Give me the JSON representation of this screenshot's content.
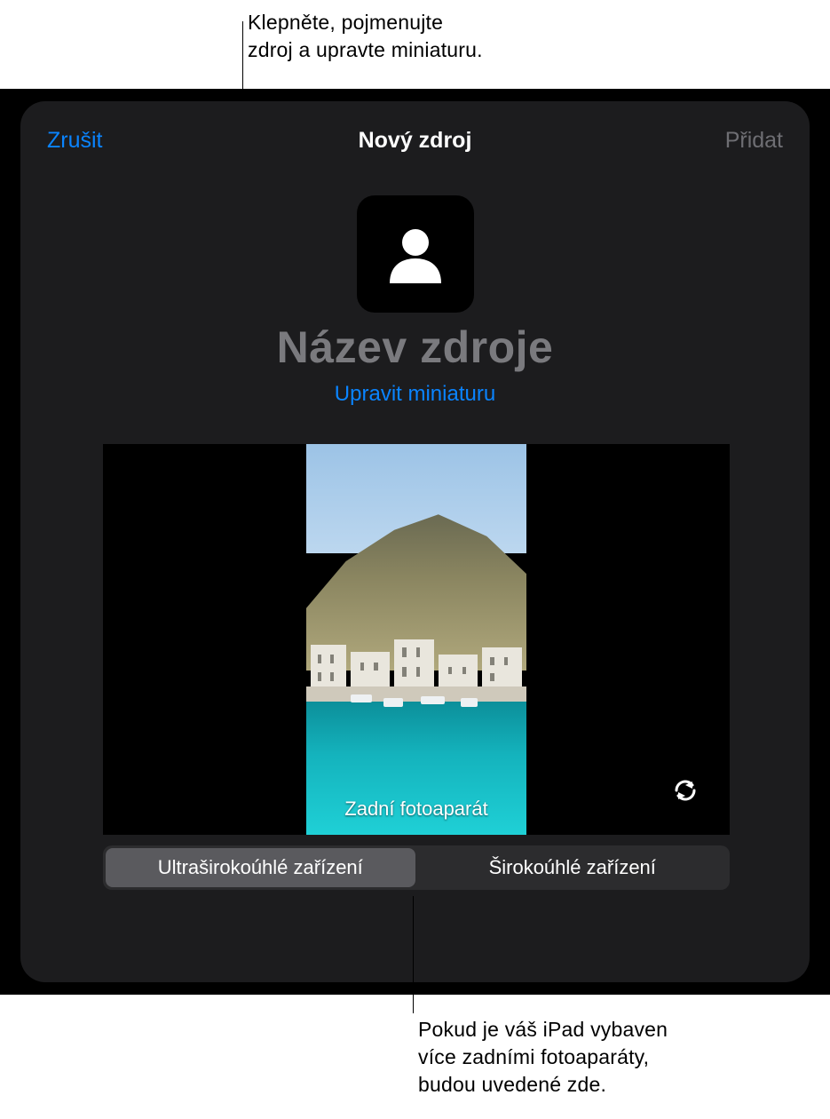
{
  "callouts": {
    "top": "Klepněte, pojmenujte\nzdroj a upravte miniaturu.",
    "bottom": "Pokud je váš iPad vybaven\nvíce zadními fotoaparáty,\nbudou uvedené zde."
  },
  "sheet": {
    "cancel": "Zrušit",
    "title": "Nový zdroj",
    "add": "Přidat",
    "source_name_placeholder": "Název zdroje",
    "edit_thumbnail": "Upravit miniaturu",
    "camera_label": "Zadní fotoaparát"
  },
  "segments": {
    "options": [
      "Ultraširokoúhlé zařízení",
      "Širokoúhlé zařízení"
    ],
    "selected_index": 0
  },
  "colors": {
    "accent": "#0a84ff",
    "sheet_bg": "#1c1c1e",
    "segmented_bg": "#2c2c2e",
    "segmented_selected": "#5a5a5e",
    "disabled_text": "#6e6e73",
    "placeholder_text": "#7a7a7e"
  }
}
